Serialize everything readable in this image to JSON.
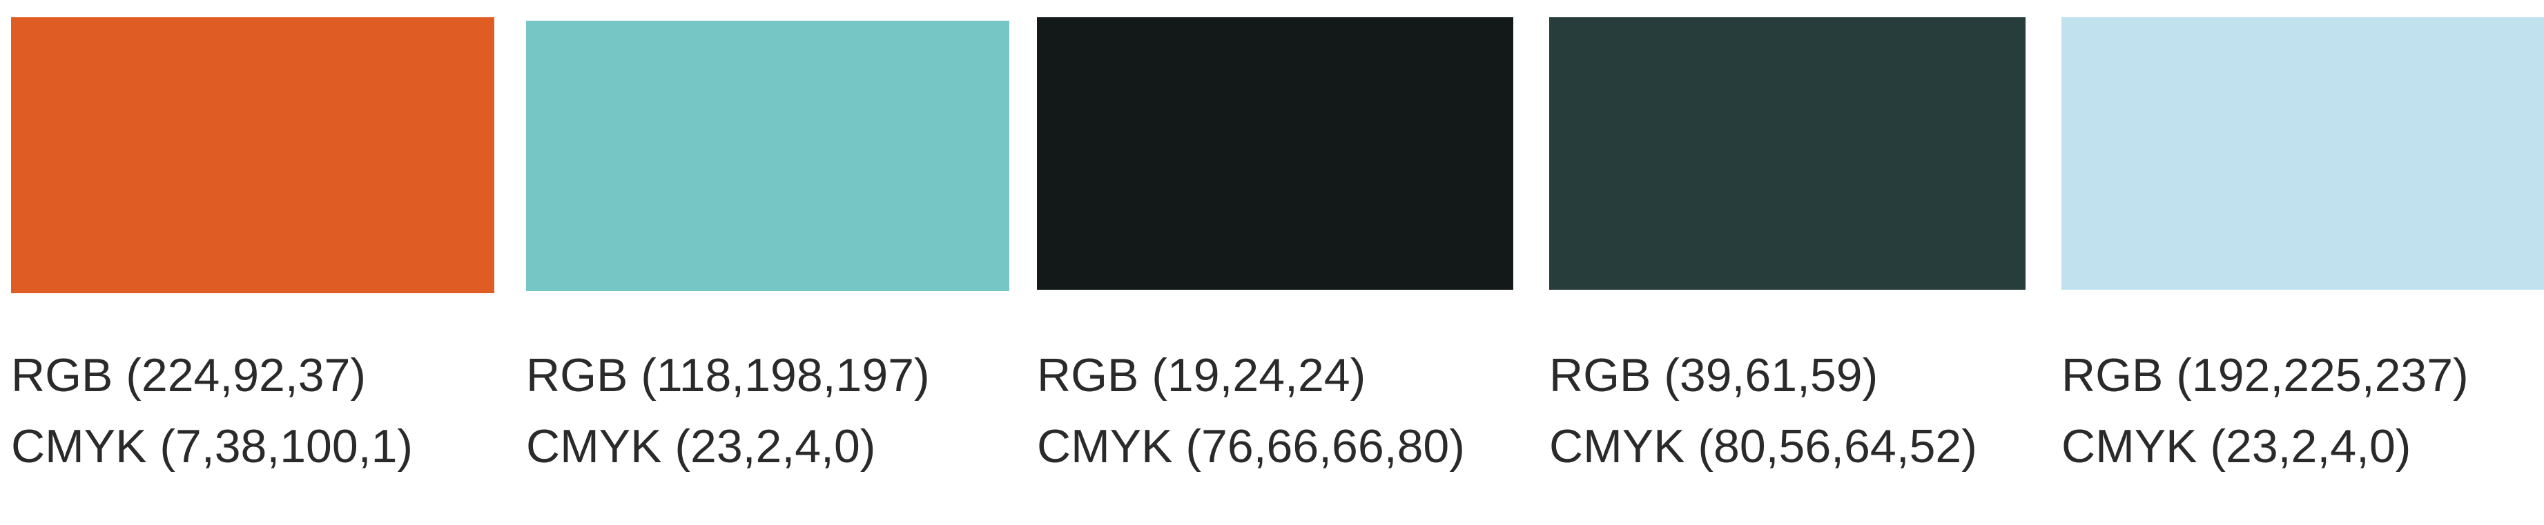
{
  "swatches": [
    {
      "color": "#E05C25",
      "rgb": "RGB (224,92,37)",
      "cmyk": "CMYK (7,38,100,1)"
    },
    {
      "color": "#76C6C5",
      "rgb": "RGB (118,198,197)",
      "cmyk": "CMYK (23,2,4,0)"
    },
    {
      "color": "#131818",
      "rgb": "RGB (19,24,24)",
      "cmyk": "CMYK (76,66,66,80)"
    },
    {
      "color": "#273D3B",
      "rgb": "RGB (39,61,59)",
      "cmyk": "CMYK (80,56,64,52)"
    },
    {
      "color": "#C0E1ED",
      "rgb": "RGB (192,225,237)",
      "cmyk": "CMYK (23,2,4,0)"
    }
  ]
}
